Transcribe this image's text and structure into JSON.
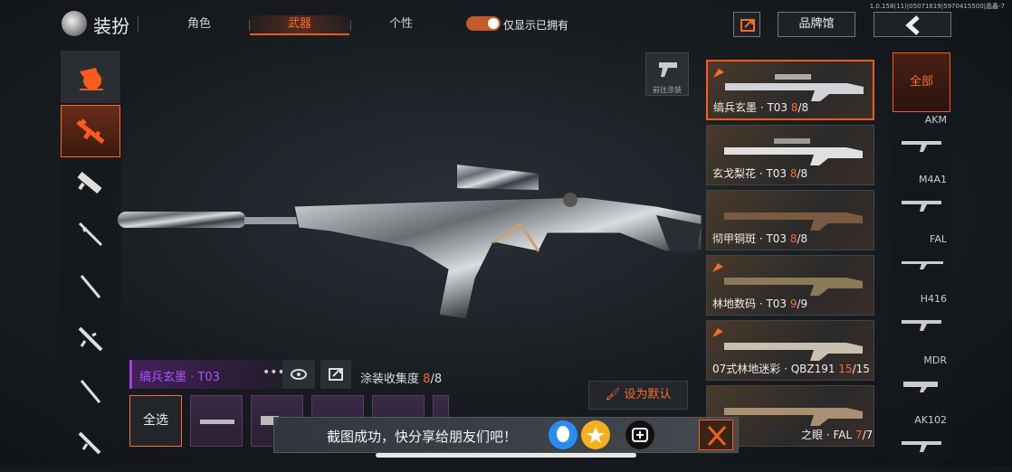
{
  "version": "1.0.158(11)|05071619|5970415500|晶鑫-7",
  "header": {
    "title": "装扮",
    "tabs": [
      {
        "label": "角色",
        "active": false
      },
      {
        "label": "武器",
        "active": true
      },
      {
        "label": "个性",
        "active": false
      }
    ],
    "toggle_label": "仅显示已拥有",
    "toggle_on": true,
    "brand_label": "品牌馆"
  },
  "left_categories": [
    "top-category-icon",
    "rifle-icon",
    "smg-icon",
    "sniper-icon",
    "marksman-icon",
    "lmg-icon",
    "shotgun-icon",
    "pistol-icon"
  ],
  "paint_shortcut_label": "前往涂装",
  "skin_info": {
    "name": "缟兵玄墨 · T03",
    "collection_label": "涂装收集度",
    "collected": "8",
    "total": "/8"
  },
  "set_default_label": "设为默认",
  "select_all_label": "全选",
  "skins": [
    {
      "name": "缟兵玄墨 · T03 ",
      "count": "8",
      "total": "/8",
      "selected": true
    },
    {
      "name": "玄戈梨花 · T03 ",
      "count": "8",
      "total": "/8",
      "selected": false
    },
    {
      "name": "彻甲铜斑 · T03 ",
      "count": "8",
      "total": "/8",
      "selected": false
    },
    {
      "name": "林地数码 · T03 ",
      "count": "9",
      "total": "/9",
      "selected": false
    },
    {
      "name": "07式林地迷彩 · QBZ191 ",
      "count": "15",
      "total": "/15",
      "selected": false
    },
    {
      "name": "之眼 · FAL ",
      "count": "7",
      "total": "/7",
      "selected": false
    }
  ],
  "weapon_filter": {
    "all_label": "全部",
    "types": [
      "AKM",
      "M4A1",
      "FAL",
      "H416",
      "MDR",
      "AK102"
    ]
  },
  "toast": {
    "text": "截图成功，快分享给朋友们吧！"
  },
  "colors": {
    "accent": "#ff5a1f",
    "rarity_purple": "#b050ff"
  }
}
